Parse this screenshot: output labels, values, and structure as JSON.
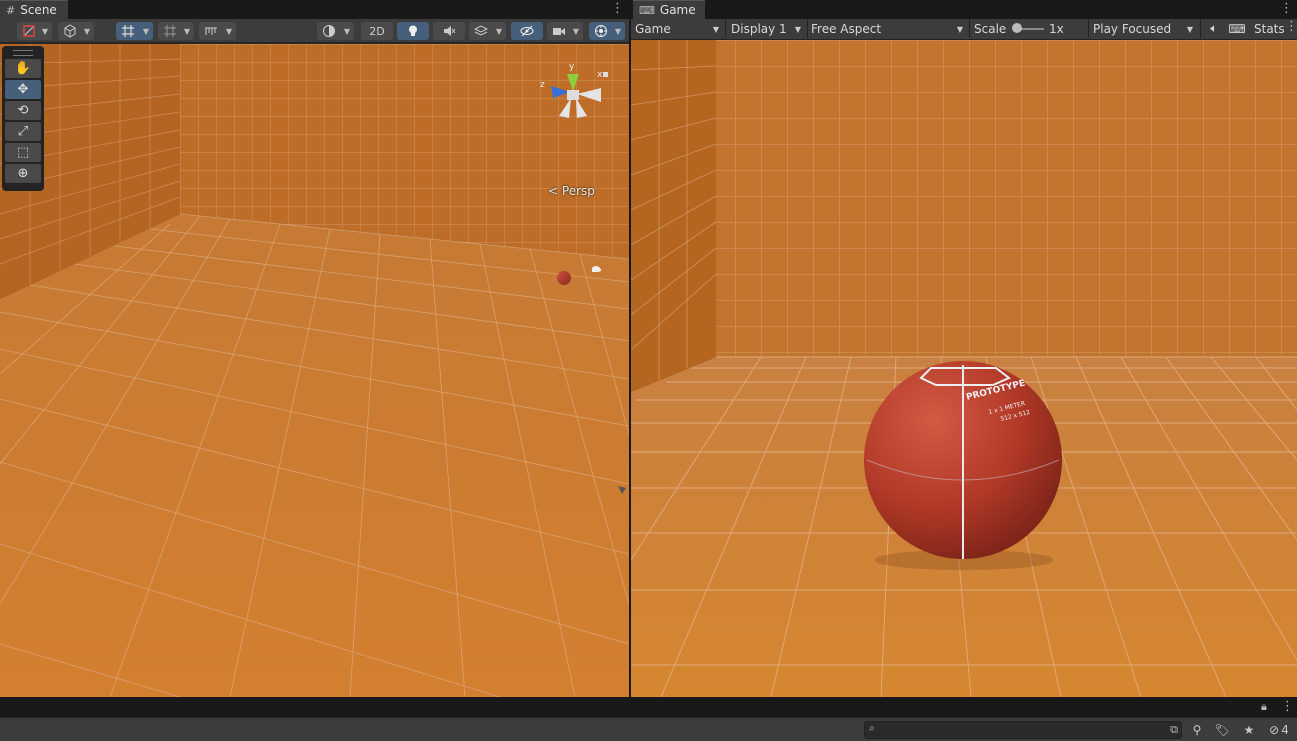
{
  "scene": {
    "tab_label": "Scene",
    "toolbar": {
      "mode_2d_label": "2D"
    },
    "camera_label": "Persp",
    "gizmo_axes": {
      "x": "x",
      "y": "y",
      "z": "z"
    }
  },
  "game": {
    "tab_label": "Game",
    "view_select": "Game",
    "display_select": "Display 1",
    "aspect_select": "Free Aspect",
    "scale_label": "Scale",
    "scale_value": "1x",
    "play_mode_select": "Play Focused",
    "stats_label": "Stats",
    "ball_text": {
      "line1": "PROTOTYPE",
      "line2": "1 x 1 METER",
      "line3": "512 x 512"
    }
  },
  "bottom": {
    "search_placeholder": "",
    "hidden_count": "4"
  },
  "colors": {
    "floor": "#c7782e",
    "wall": "#b86a24",
    "ball": "#b53a2a",
    "active_button": "#46607c"
  },
  "icons": {
    "scene_tab": "hash-icon",
    "game_tab": "gamepad-icon",
    "tools": [
      "hand-icon",
      "move-icon",
      "rotate-icon",
      "scale-icon",
      "rect-icon",
      "transform-icon"
    ]
  }
}
